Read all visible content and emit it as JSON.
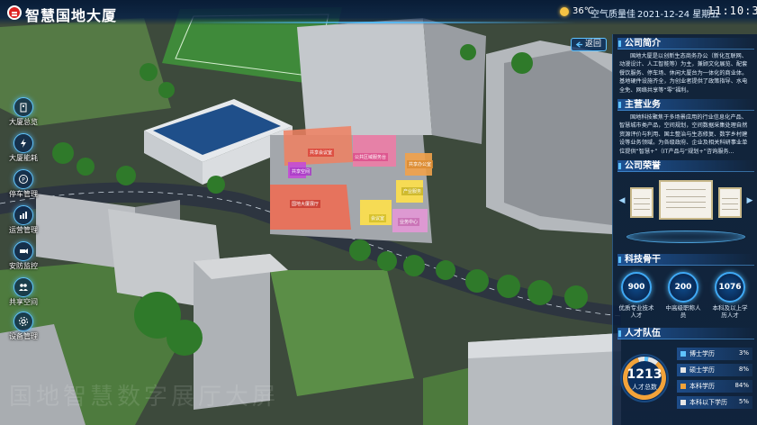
{
  "header": {
    "title": "智慧国地大厦",
    "temperature": "36℃",
    "air_quality": "空气质量佳",
    "date": "2021-12-24 星期五",
    "time": "11:10:36"
  },
  "nav": {
    "items": [
      {
        "label": "大厦总览",
        "icon": "building-overview-icon"
      },
      {
        "label": "大厦能耗",
        "icon": "energy-icon"
      },
      {
        "label": "停车管理",
        "icon": "parking-icon"
      },
      {
        "label": "运营管理",
        "icon": "operations-icon"
      },
      {
        "label": "安防监控",
        "icon": "security-camera-icon"
      },
      {
        "label": "共享空间",
        "icon": "shared-space-icon"
      },
      {
        "label": "设备管理",
        "icon": "device-icon"
      }
    ]
  },
  "right_panel": {
    "back_label": "返回",
    "company_intro": {
      "title": "公司简介",
      "text": "国地大厦是以创新生态商务办公（新化互联网、动漫设计、人工智能等）为主，兼顾文化展览、配套餐饮服务、停车场、休闲大厦台为一体化的商业体。基地硬件设施齐全，为创业者提供了政策指导、水电全免、网络共享等“零”福利。"
    },
    "main_business": {
      "title": "主营业务",
      "text": "国地科技聚焦于多场景应用的行业信息化产品、智慧城市类产品，空间规划，空间数据采集处理自然资源评价与利用、国土整治与生态修复、数字乡村建设等业务领域。为各级政府、企业及相关科研事业单位提供“智慧+”（IT产品与“规划+”咨询服务..."
    },
    "honors": {
      "title": "公司荣誉",
      "prev_icon": "chevron-left-icon",
      "next_icon": "chevron-right-icon"
    },
    "tech_backbone": {
      "title": "科技骨干",
      "stats": [
        {
          "value": "900",
          "label": "优质专业技术人才"
        },
        {
          "value": "200",
          "label": "中高级职称人员"
        },
        {
          "value": "1076",
          "label": "本科及以上学历人才"
        }
      ]
    },
    "talent_team": {
      "title": "人才队伍",
      "total_value": "1213",
      "total_label": "人才总数",
      "education": [
        {
          "label": "博士学历",
          "value": "3%",
          "fraction": 0.03,
          "color": "#5fc3ff"
        },
        {
          "label": "硕士学历",
          "value": "8%",
          "fraction": 0.08,
          "color": "#e6e6e6"
        },
        {
          "label": "本科学历",
          "value": "84%",
          "fraction": 0.84,
          "color": "#f2a33a"
        },
        {
          "label": "本科以下学历",
          "value": "5%",
          "fraction": 0.05,
          "color": "#e6e6e6"
        }
      ]
    }
  },
  "scene_labels": [
    "共享会议室",
    "公共区域服务台",
    "国地大厦展厅",
    "共享空间",
    "共享办公室",
    "会议室",
    "产业服务",
    "业务中心",
    "休闲区"
  ],
  "watermark": "国地智慧数字展厅大屏"
}
